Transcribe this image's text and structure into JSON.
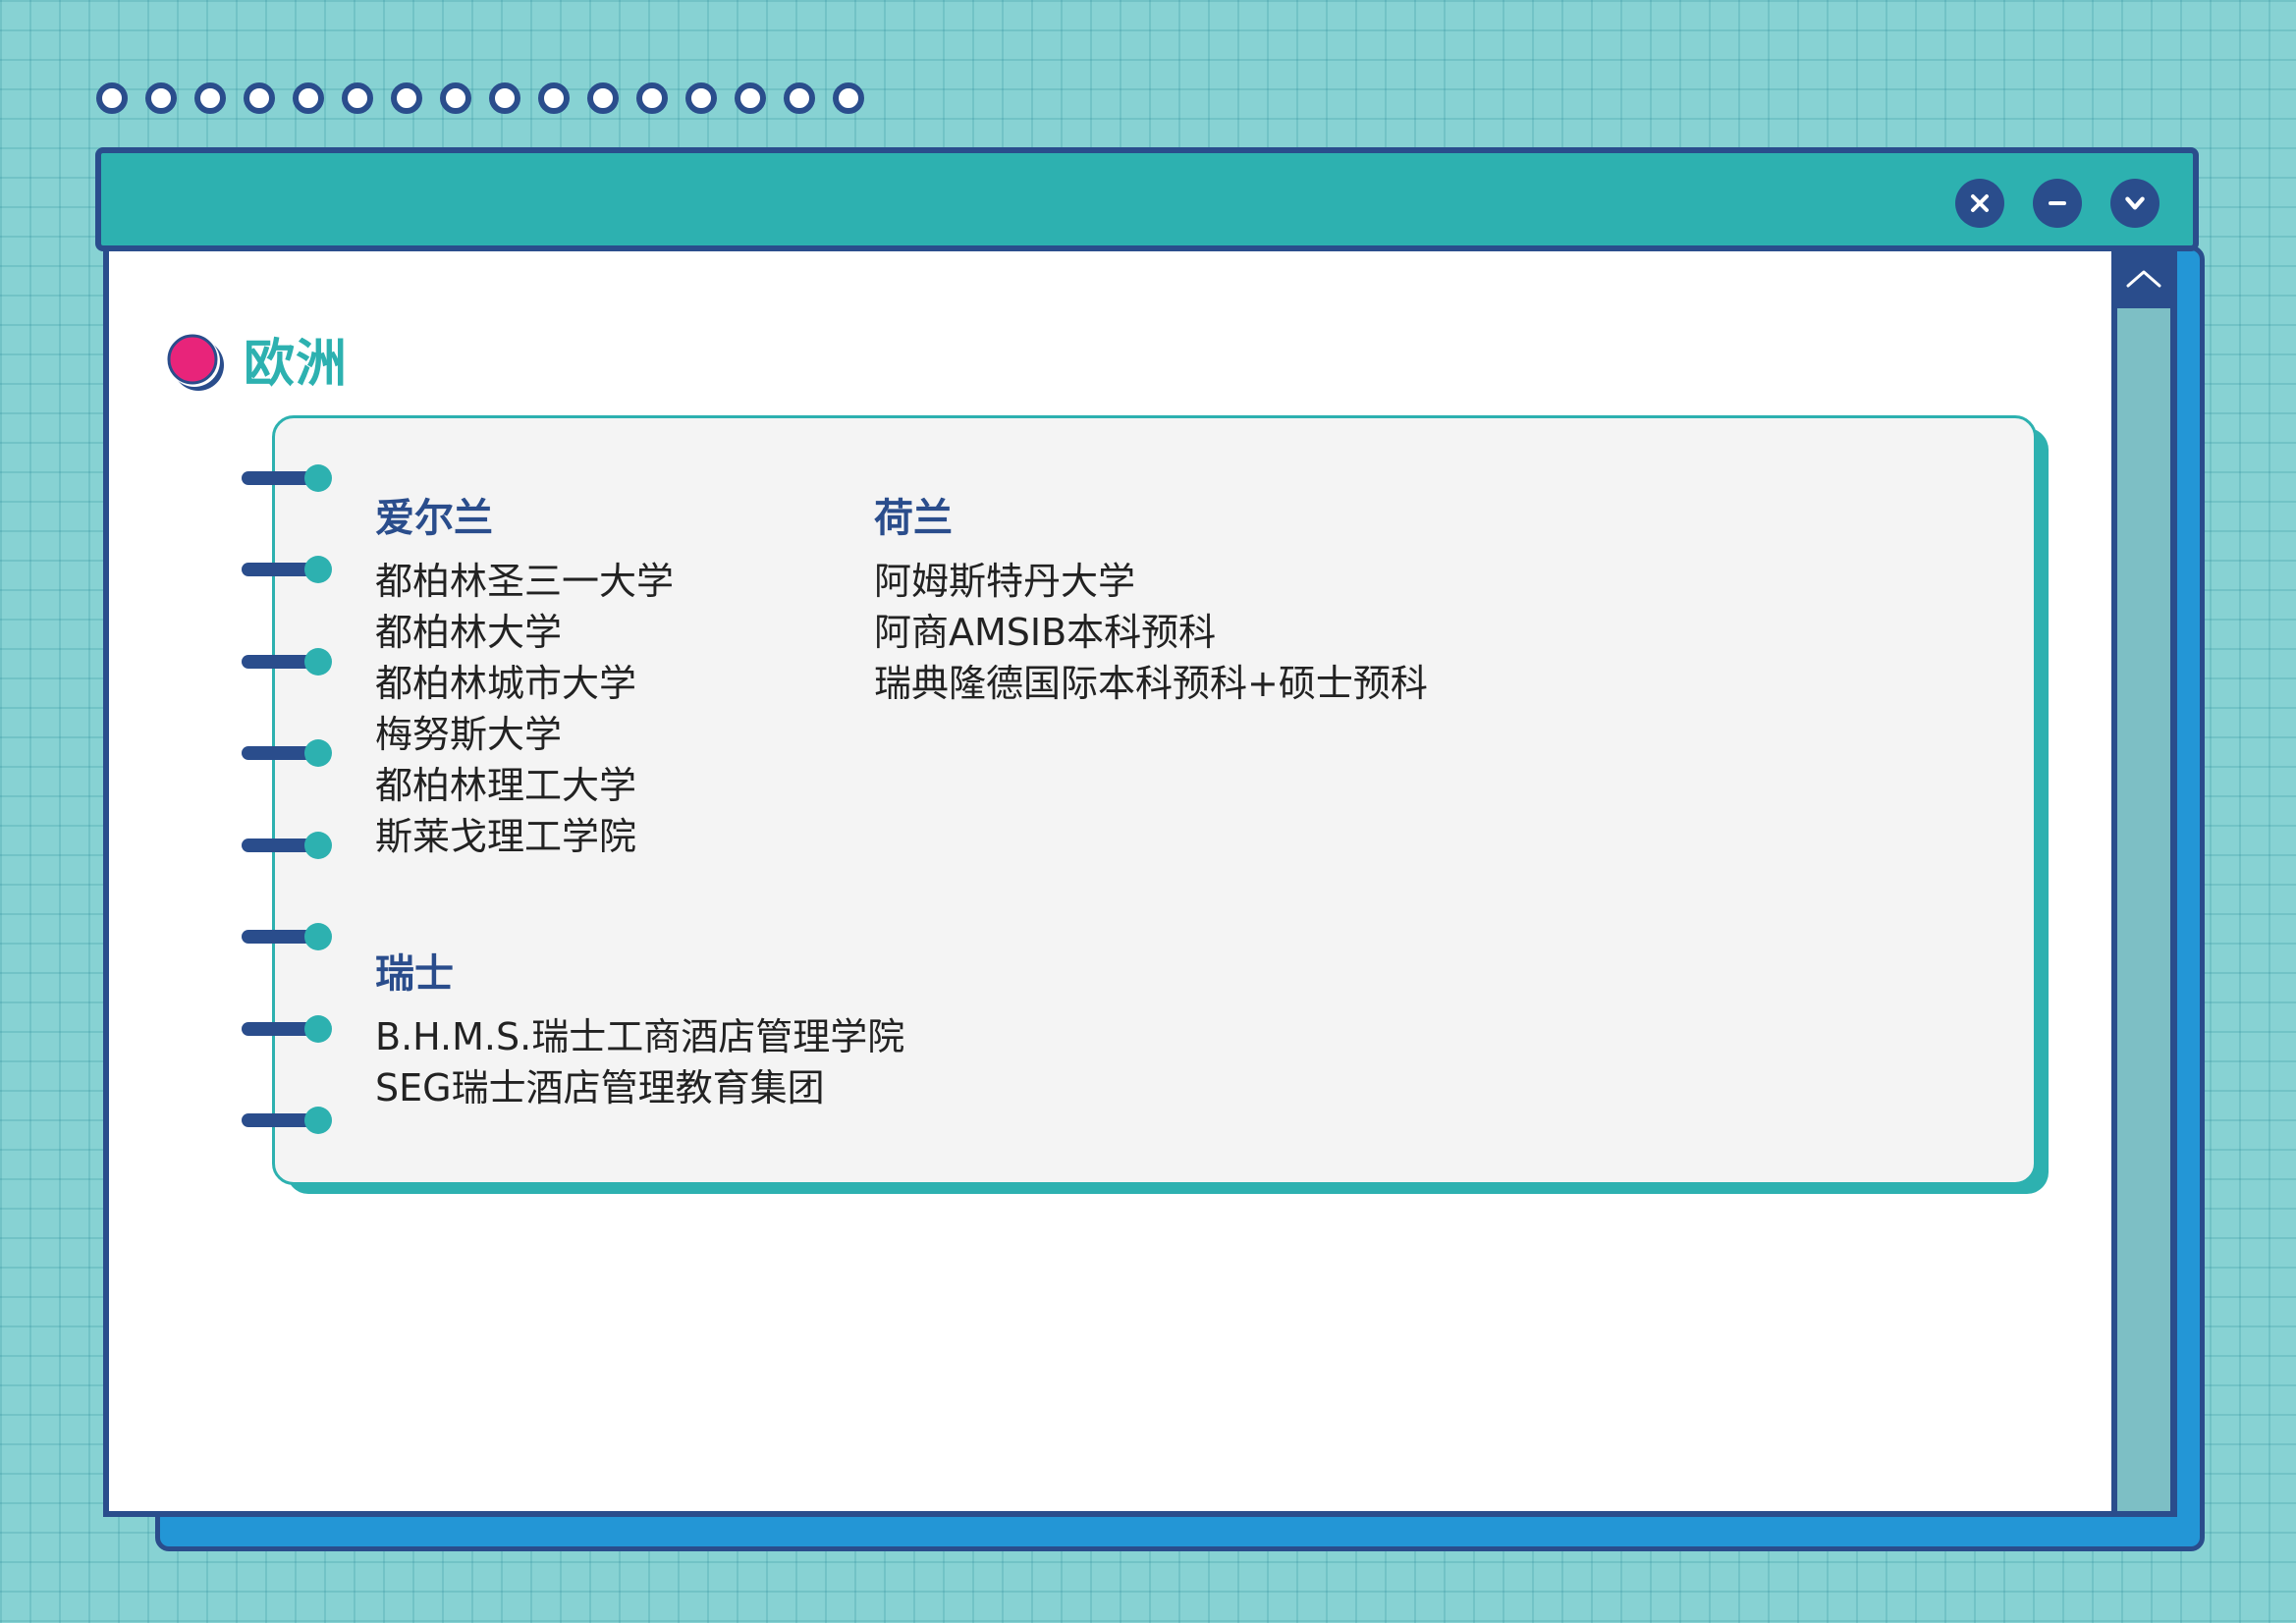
{
  "section": {
    "title": "欧洲"
  },
  "window": {
    "controls": [
      {
        "icon": "close-icon"
      },
      {
        "icon": "minimize-icon"
      },
      {
        "icon": "chevron-down-icon"
      }
    ],
    "scroll_up_icon": "chevron-up-icon"
  },
  "regions": {
    "ireland": {
      "heading": "爱尔兰",
      "schools": [
        "都柏林圣三一大学",
        "都柏林大学",
        "都柏林城市大学",
        "梅努斯大学",
        "都柏林理工大学",
        "斯莱戈理工学院"
      ]
    },
    "netherlands": {
      "heading": "荷兰",
      "schools": [
        "阿姆斯特丹大学",
        "阿商AMSIB本科预科",
        "瑞典隆德国际本科预科+硕士预科"
      ]
    },
    "switzerland": {
      "heading": "瑞士",
      "schools": [
        "B.H.M.S.瑞士工商酒店管理学院",
        "SEG瑞士酒店管理教育集团"
      ]
    }
  },
  "colors": {
    "background": "#87d2d3",
    "frame": "#2a4d8c",
    "teal": "#2db1b0",
    "blue_shadow": "#2396d6",
    "marker_pink": "#e8247a"
  }
}
